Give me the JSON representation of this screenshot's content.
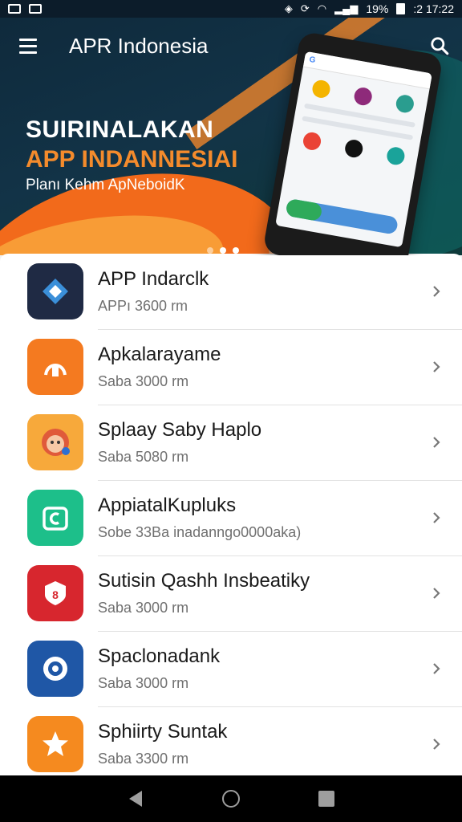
{
  "status_bar": {
    "battery_percent": "19%",
    "time": ":2 17:22"
  },
  "app_bar": {
    "title": "APR Indonesia"
  },
  "hero": {
    "headline_line1": "SUIRINALAKAN",
    "headline_line2": "APP INDANNESIAI",
    "subtitle": "Planı Kehm ApNeboidK",
    "carousel_pages": 3,
    "carousel_active": 3
  },
  "apps": [
    {
      "title": "APP Indarclk",
      "subtitle": "APPı 3600 rm",
      "icon": "diamond-arrows-icon",
      "icon_bg": "#1f2a44"
    },
    {
      "title": "Apkalarayame",
      "subtitle": "Saba 3000 rm",
      "icon": "bag-icon",
      "icon_bg": "#f47a20"
    },
    {
      "title": "Splaay Saby Haplo",
      "subtitle": "Saba 5080 rm",
      "icon": "face-icon",
      "icon_bg": "#f7a93b"
    },
    {
      "title": "AppiatalKupluks",
      "subtitle": "Sobe 33Ba inadanngo0000aka)",
      "icon": "c-letter-icon",
      "icon_bg": "#1dbf8a"
    },
    {
      "title": "Sutisin Qashh Insbeatiky",
      "subtitle": "Saba 3000 rm",
      "icon": "shield-icon",
      "icon_bg": "#d7262e"
    },
    {
      "title": "Spaclonadank",
      "subtitle": "Saba 3000 rm",
      "icon": "gear-badge-icon",
      "icon_bg": "#1f57a6"
    },
    {
      "title": "Sphiirty Suntak",
      "subtitle": "Saba 3300 rm",
      "icon": "star-icon",
      "icon_bg": "#f58a1f"
    }
  ],
  "colors": {
    "accent_orange": "#f48b2c",
    "banner_dark": "#0f2a3c"
  }
}
